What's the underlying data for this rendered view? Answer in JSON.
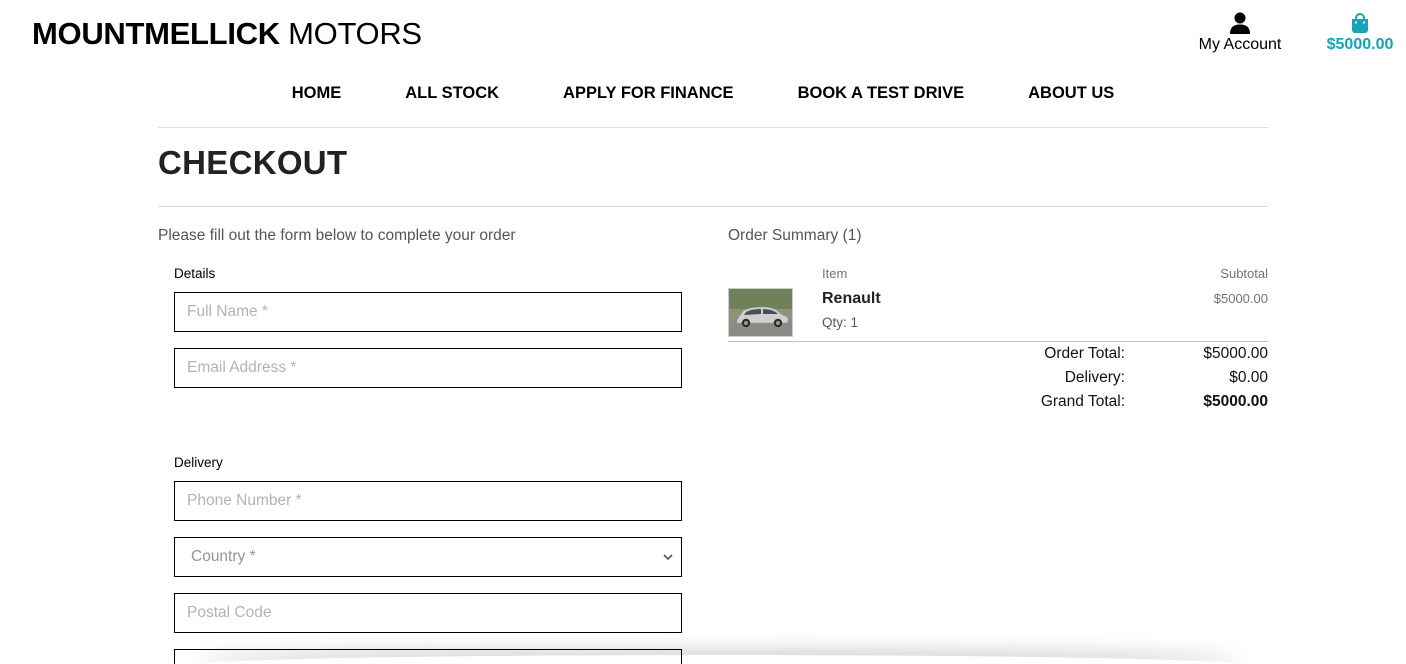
{
  "brand": {
    "bold": "MOUNTMELLICK",
    "light": " MOTORS"
  },
  "account": {
    "label": "My Account",
    "icon": "user-icon"
  },
  "cart": {
    "total": "$5000.00",
    "icon": "shopping-bag-icon",
    "color": "#17a2b8"
  },
  "nav": {
    "items": [
      "HOME",
      "ALL STOCK",
      "APPLY FOR FINANCE",
      "BOOK A TEST DRIVE",
      "ABOUT US"
    ]
  },
  "page": {
    "title": "CHECKOUT",
    "intro": "Please fill out the form below to complete your order"
  },
  "form": {
    "details_label": "Details",
    "full_name_placeholder": "Full Name *",
    "email_placeholder": "Email Address *",
    "delivery_label": "Delivery",
    "phone_placeholder": "Phone Number *",
    "country_placeholder": "Country *",
    "postal_placeholder": "Postal Code"
  },
  "summary": {
    "title": "Order Summary (1)",
    "col_item": "Item",
    "col_subtotal": "Subtotal",
    "items": [
      {
        "name": "Renault",
        "qty": "Qty: 1",
        "subtotal": "$5000.00"
      }
    ],
    "order_total_label": "Order Total:",
    "order_total": "$5000.00",
    "delivery_label": "Delivery:",
    "delivery": "$0.00",
    "grand_total_label": "Grand Total:",
    "grand_total": "$5000.00"
  }
}
